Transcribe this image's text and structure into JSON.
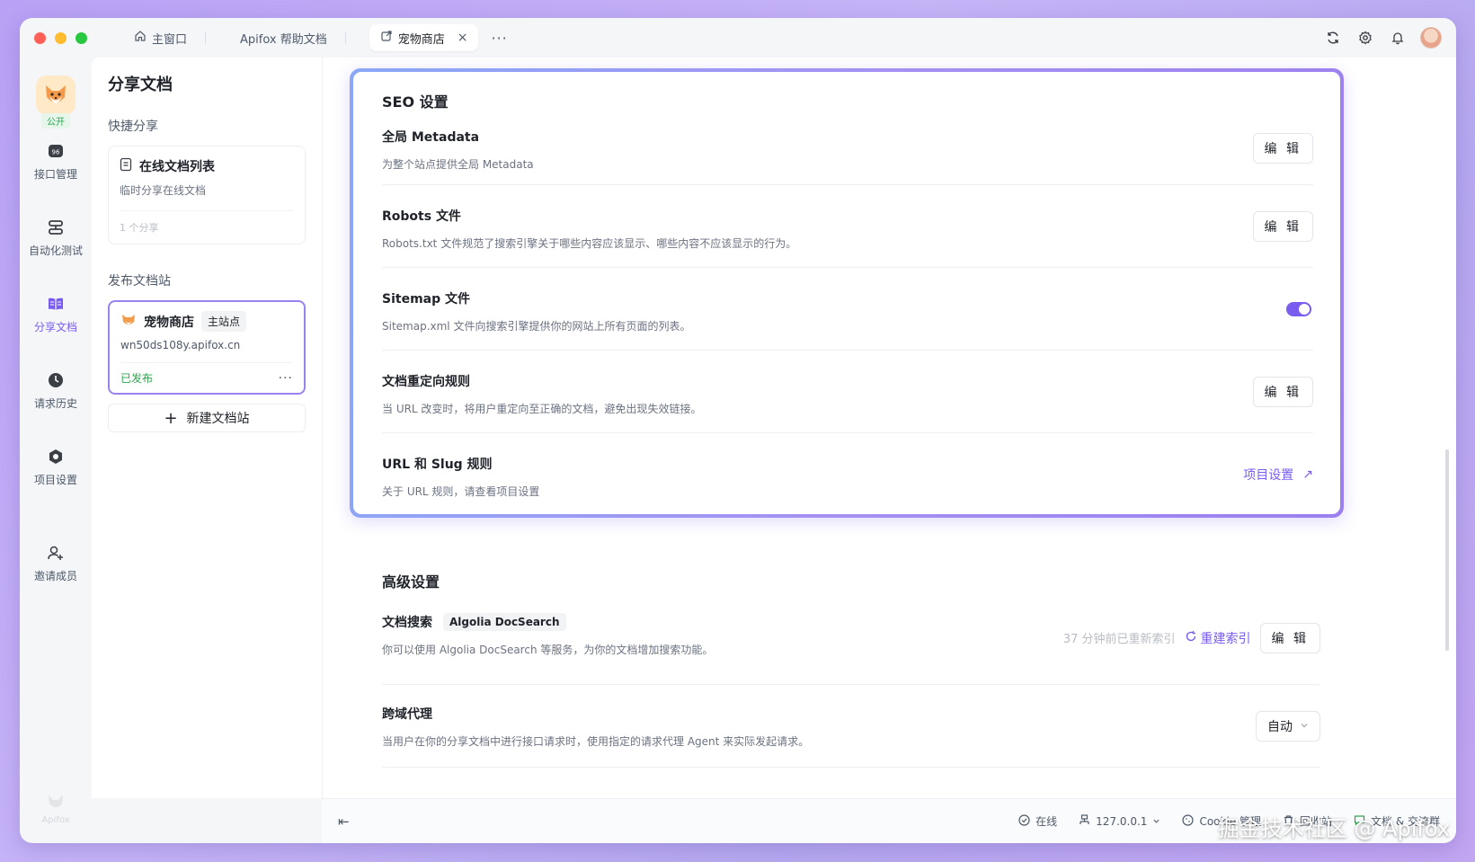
{
  "tabs": [
    {
      "label": "主窗口",
      "icon": "home-icon"
    },
    {
      "label": "Apifox 帮助文档"
    },
    {
      "label": "宠物商店",
      "icon": "share-doc-icon",
      "close": "×"
    }
  ],
  "tab_more": "···",
  "rail": {
    "badge": "公开",
    "items": [
      {
        "label": "接口管理",
        "icon": "api-icon"
      },
      {
        "label": "自动化测试",
        "icon": "automation-icon"
      },
      {
        "label": "分享文档",
        "icon": "book-icon"
      },
      {
        "label": "请求历史",
        "icon": "clock-icon"
      },
      {
        "label": "项目设置",
        "icon": "hexagon-settings-icon"
      },
      {
        "label": "邀请成员",
        "icon": "user-add-icon"
      }
    ],
    "brand": "Apifox"
  },
  "sidebar": {
    "title": "分享文档",
    "quick_share_label": "快捷分享",
    "quick_card": {
      "title": "在线文档列表",
      "desc": "临时分享在线文档",
      "foot": "1 个分享"
    },
    "publish_label": "发布文档站",
    "site_card": {
      "name": "宠物商店",
      "tag": "主站点",
      "url": "wn50ds108y.apifox.cn",
      "status": "已发布",
      "more": "···"
    },
    "new_site": "新建文档站",
    "new_site_plus": "+"
  },
  "seo": {
    "title": "SEO 设置",
    "rows": [
      {
        "title": "全局 Metadata",
        "desc": "为整个站点提供全局 Metadata",
        "action": "编 辑"
      },
      {
        "title": "Robots 文件",
        "desc": "Robots.txt 文件规范了搜索引擎关于哪些内容应该显示、哪些内容不应该显示的行为。",
        "action": "编 辑"
      },
      {
        "title": "Sitemap 文件",
        "desc": "Sitemap.xml 文件向搜索引擎提供你的网站上所有页面的列表。",
        "toggle": true
      },
      {
        "title": "文档重定向规则",
        "desc": "当 URL 改变时，将用户重定向至正确的文档，避免出现失效链接。",
        "action": "编 辑"
      },
      {
        "title": "URL 和 Slug 规则",
        "desc": "关于 URL 规则，请查看项目设置",
        "link": "项目设置",
        "link_icon": "↗"
      }
    ]
  },
  "advanced": {
    "title": "高级设置",
    "search": {
      "title": "文档搜索",
      "tag": "Algolia DocSearch",
      "desc": "你可以使用 Algolia DocSearch 等服务，为你的文档增加搜索功能。",
      "last_indexed": "37 分钟前已重新索引",
      "reindex": "重建索引",
      "action": "编 辑"
    },
    "proxy": {
      "title": "跨域代理",
      "desc": "当用户在你的分享文档中进行接口请求时，使用指定的请求代理 Agent 来实际发起请求。",
      "value": "自动"
    }
  },
  "statusbar": {
    "collapse": "⇤",
    "online": "在线",
    "host": "127.0.0.1",
    "cookie": "Cookie 管理",
    "recycle": "回收站",
    "community": "文档 & 交流群"
  },
  "watermark": "掘金技术社区 @ Apifox",
  "colors": {
    "accent": "#7a5cf0",
    "success": "#2ea44f"
  }
}
